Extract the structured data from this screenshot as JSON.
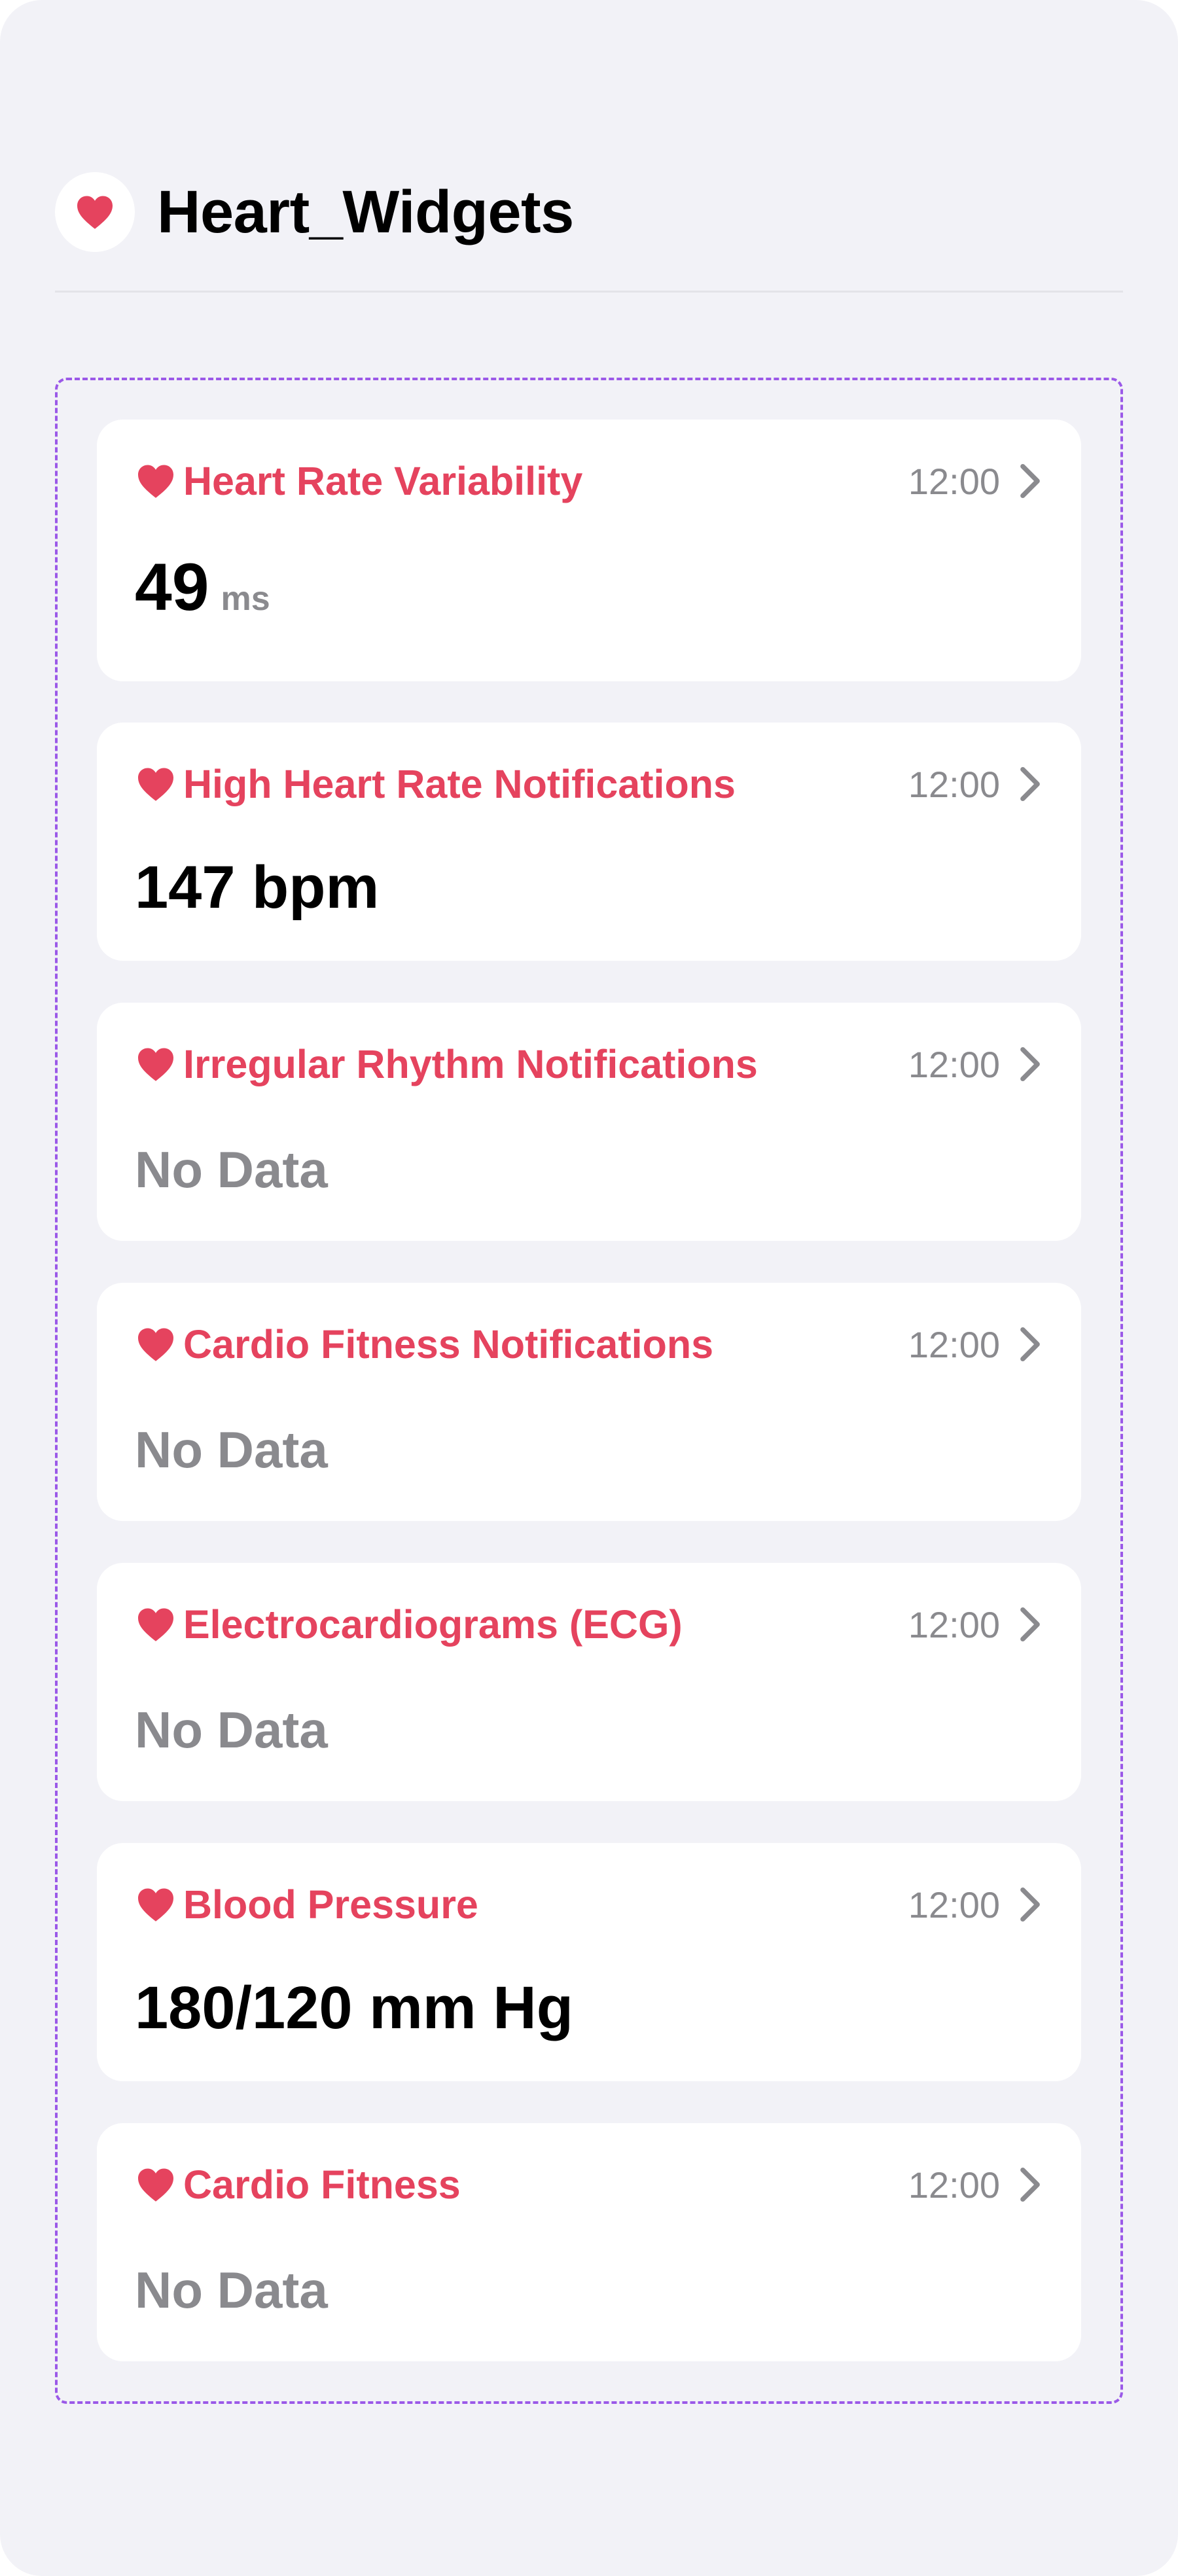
{
  "header": {
    "title": "Heart_Widgets",
    "icon": "heart-icon"
  },
  "colors": {
    "accent": "#e5435e",
    "background": "#f2f2f7",
    "card": "#ffffff",
    "secondary_text": "#8a8a8e",
    "container_border": "#9b59e8"
  },
  "widgets": [
    {
      "title": "Heart Rate Variability",
      "time": "12:00",
      "value": "49",
      "unit": "ms",
      "icon": "heart-icon"
    },
    {
      "title": "High Heart Rate Notifications",
      "time": "12:00",
      "value": "147 bpm",
      "icon": "heart-icon"
    },
    {
      "title": "Irregular Rhythm Notifications",
      "time": "12:00",
      "value": "No Data",
      "icon": "heart-icon"
    },
    {
      "title": "Cardio Fitness Notifications",
      "time": "12:00",
      "value": "No Data",
      "icon": "heart-icon"
    },
    {
      "title": "Electrocardiograms (ECG)",
      "time": "12:00",
      "value": "No Data",
      "icon": "heart-icon"
    },
    {
      "title": "Blood Pressure",
      "time": "12:00",
      "value": "180/120 mm Hg",
      "icon": "heart-icon"
    },
    {
      "title": "Cardio Fitness",
      "time": "12:00",
      "value": "No Data",
      "icon": "heart-icon"
    }
  ]
}
